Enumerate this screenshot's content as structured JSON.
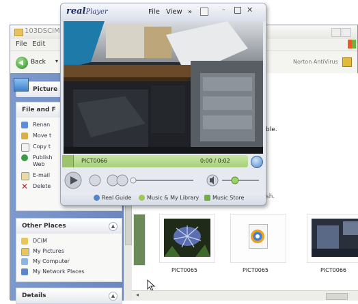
{
  "explorer": {
    "title": "103DSCIM",
    "menu": [
      "File",
      "Edit"
    ],
    "toolbar": {
      "back_label": "Back",
      "norton_label": "Norton AntiVirus"
    },
    "left_panel": {
      "pictures_tasks_title": "Picture",
      "file_folder_title": "File and F",
      "file_tasks": [
        "Renan",
        "Move t",
        "Copy t",
        "Publish Web",
        "E-mail",
        "Delete"
      ],
      "other_places_title": "Other Places",
      "other_places": [
        "DCIM",
        "My Pictures",
        "My Computer",
        "My Network Places"
      ],
      "details_title": "Details"
    },
    "main": {
      "behind_text": "ble.",
      "behind_text2": "sh.",
      "files": [
        {
          "name": "PICT0065",
          "type": "photo"
        },
        {
          "name": "PICT0065",
          "type": "video"
        },
        {
          "name": "PICT0066",
          "type": "photo"
        }
      ]
    }
  },
  "realplayer": {
    "logo_brand": "real",
    "logo_product": "Player",
    "menu": [
      "File",
      "View",
      "»"
    ],
    "status": {
      "clip_name": "PICT0066",
      "time": "0:00 / 0:02"
    },
    "links": [
      "Real Guide",
      "Music & My Library",
      "Music Store"
    ],
    "volume": 0.35
  }
}
